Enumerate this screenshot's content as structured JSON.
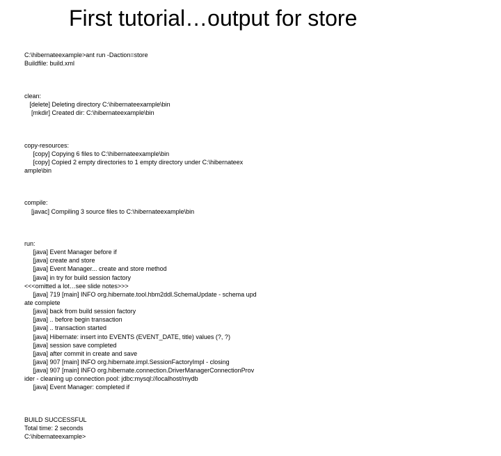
{
  "title": "First tutorial…output for store",
  "blocks": {
    "b0": "C:\\hibernateexample>ant run -Daction=store\nBuildfile: build.xml",
    "b1": "clean:\n   [delete] Deleting directory C:\\hibernateexample\\bin\n    [mkdir] Created dir: C:\\hibernateexample\\bin",
    "b2": "copy-resources:\n     [copy] Copying 6 files to C:\\hibernateexample\\bin\n     [copy] Copied 2 empty directories to 1 empty directory under C:\\hibernateex\nample\\bin",
    "b3": "compile:\n    [javac] Compiling 3 source files to C:\\hibernateexample\\bin",
    "b4": "run:\n     [java] Event Manager before if\n     [java] create and store\n     [java] Event Manager... create and store method\n     [java] in try for build session factory\n<<<omitted a lot…see slide notes>>>\n     [java] 719 [main] INFO org.hibernate.tool.hbm2ddl.SchemaUpdate - schema upd\nate complete\n     [java] back from build session factory\n     [java] .. before begin transaction\n     [java] .. transaction started\n     [java] Hibernate: insert into EVENTS (EVENT_DATE, title) values (?, ?)\n     [java] session save completed\n     [java] after commit in create and save\n     [java] 907 [main] INFO org.hibernate.impl.SessionFactoryImpl - closing\n     [java] 907 [main] INFO org.hibernate.connection.DriverManagerConnectionProv\nider - cleaning up connection pool: jdbc:mysql://localhost/mydb\n     [java] Event Manager: completed if",
    "b5": "BUILD SUCCESSFUL\nTotal time: 2 seconds\nC:\\hibernateexample>"
  }
}
